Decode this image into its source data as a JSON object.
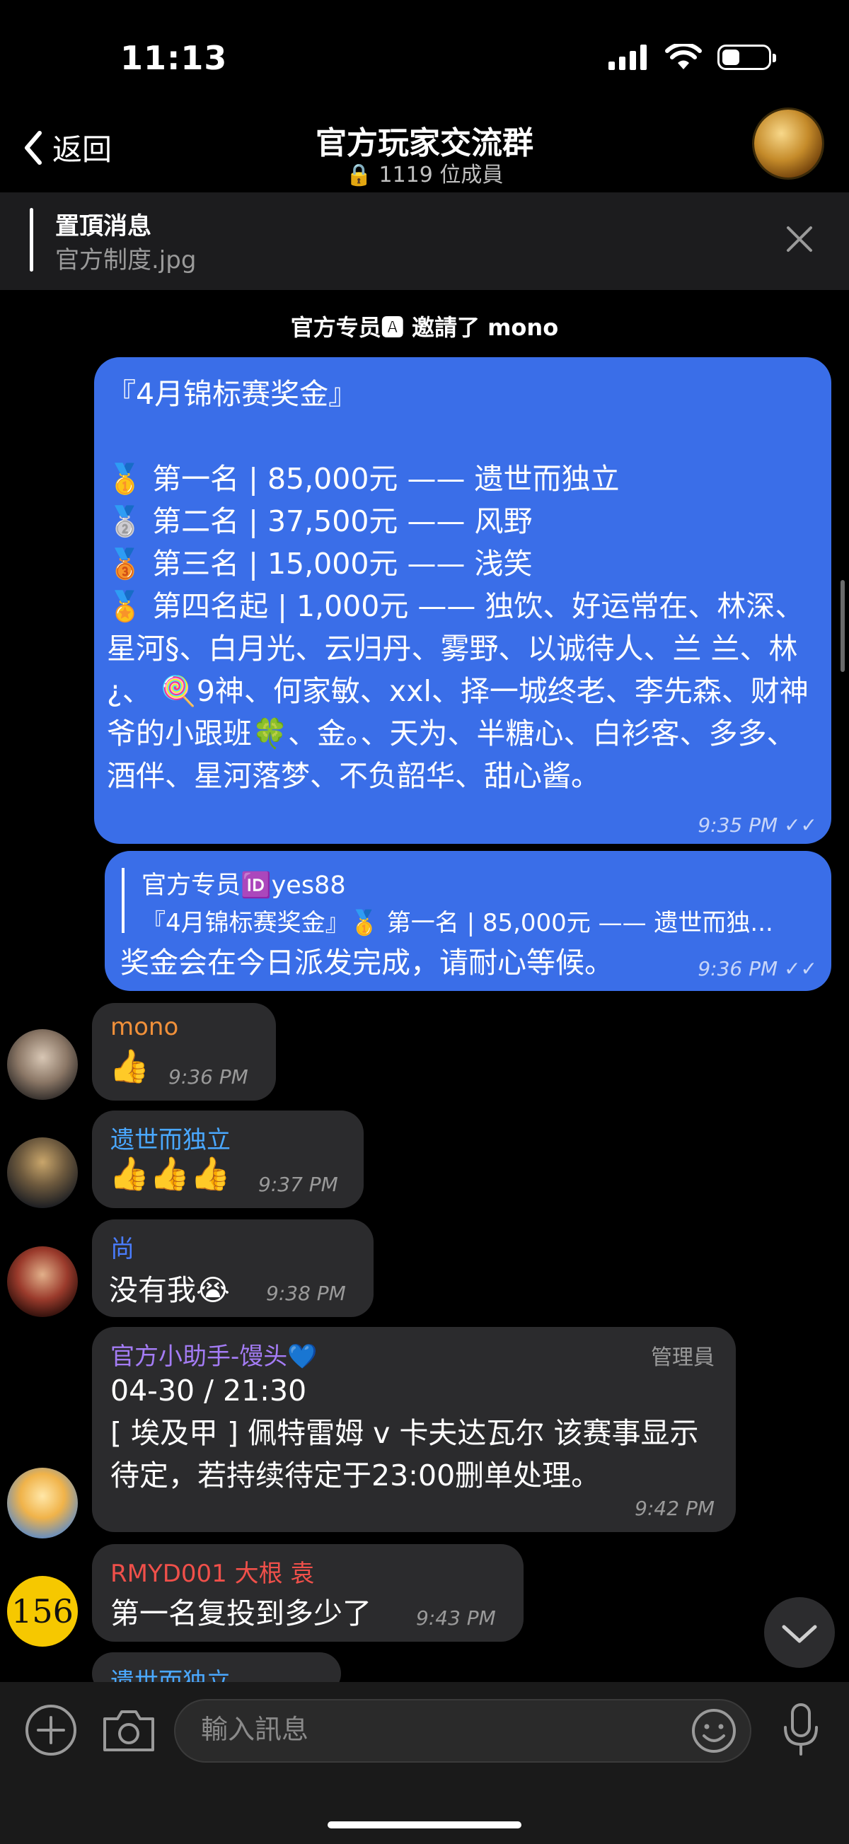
{
  "status": {
    "time": "11:13"
  },
  "nav": {
    "back_label": "返回",
    "title": "官方玩家交流群",
    "member_count": "1119 位成員"
  },
  "pinned": {
    "title": "置頂消息",
    "text": "官方制度.jpg"
  },
  "system_message": "官方专员🅰 邀請了 mono",
  "announcement": {
    "text": "『4月锦标赛奖金』\n\n🥇 第一名 | 85,000元 —— 遗世而独立\n🥈 第二名 | 37,500元 —— 风野\n🥉 第三名 | 15,000元 —— 浅笑\n🏅 第四名起 | 1,000元 —— 独饮、好运常在、林深、星河§、白月光、云归丹、雾野、以诚待人、兰 兰、林 ¿、 🍭9神、何家敏、xxl、择一城终老、李先森、财神爷的小跟班🍀、金。、天为、半糖心、白衫客、多多、酒伴、星河落梦、不负韶华、甜心酱。",
    "time": "9:35 PM"
  },
  "reply_message": {
    "quoted_sender": "官方专员🆔yes88",
    "quoted_text": "『4月锦标赛奖金』🥇 第一名 | 85,000元 —— 遗世而独...",
    "text": "奖金会在今日派发完成，请耐心等候。",
    "time": "9:36 PM"
  },
  "messages": [
    {
      "sender": "mono",
      "sender_color": "#f0903a",
      "text": "👍",
      "time": "9:36 PM"
    },
    {
      "sender": "遗世而独立",
      "sender_color": "#4aa8ff",
      "text": "👍👍👍",
      "time": "9:37 PM"
    },
    {
      "sender": "尚",
      "sender_color": "#4a7dff",
      "text": "没有我😭",
      "time": "9:38 PM"
    },
    {
      "sender": "官方小助手-馒头💙",
      "sender_color": "#a47cf5",
      "role": "管理員",
      "text": "04-30 / 21:30\n[ 埃及甲 ] 佩特雷姆 v 卡夫达瓦尔 该赛事显示待定，若持续待定于23:00删单处理。",
      "time": "9:42 PM"
    },
    {
      "sender": "RMYD001 大根 袁",
      "sender_color": "#f0504a",
      "text": "第一名复投到多少了",
      "time": "9:43 PM",
      "avatar_text": "156"
    },
    {
      "sender": "遗世而独立",
      "sender_color": "#4aa8ff"
    }
  ],
  "input": {
    "placeholder": "輸入訊息"
  },
  "colors": {
    "accent_blue": "#3a6ee8",
    "dark_bubble": "#2b2b2d",
    "background": "#000000"
  }
}
